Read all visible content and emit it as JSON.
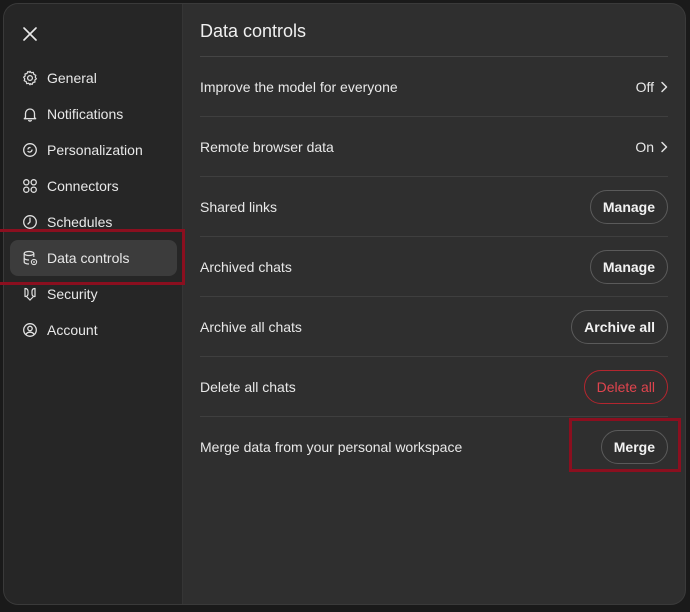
{
  "sidebar": {
    "items": [
      {
        "label": "General",
        "icon": "gear-icon"
      },
      {
        "label": "Notifications",
        "icon": "bell-icon"
      },
      {
        "label": "Personalization",
        "icon": "personalization-icon"
      },
      {
        "label": "Connectors",
        "icon": "connectors-icon"
      },
      {
        "label": "Schedules",
        "icon": "clock-icon"
      },
      {
        "label": "Data controls",
        "icon": "database-gear-icon",
        "active": true
      },
      {
        "label": "Security",
        "icon": "security-icon"
      },
      {
        "label": "Account",
        "icon": "account-icon"
      }
    ]
  },
  "main": {
    "title": "Data controls",
    "rows": [
      {
        "label": "Improve the model for everyone",
        "value": "Off"
      },
      {
        "label": "Remote browser data",
        "value": "On"
      },
      {
        "label": "Shared links",
        "button": "Manage"
      },
      {
        "label": "Archived chats",
        "button": "Manage"
      },
      {
        "label": "Archive all chats",
        "button": "Archive all"
      },
      {
        "label": "Delete all chats",
        "button": "Delete all"
      },
      {
        "label": "Merge data from your personal workspace",
        "button": "Merge"
      }
    ]
  },
  "colors": {
    "background": "#2f2f2f",
    "sidebar": "#262626",
    "danger": "#e0444e",
    "highlight": "#8b0f1f"
  }
}
